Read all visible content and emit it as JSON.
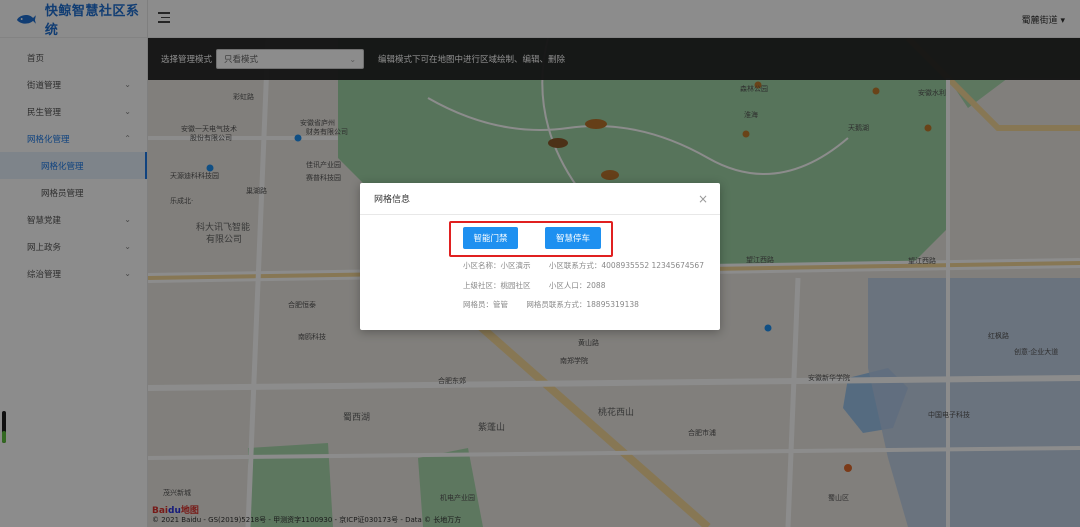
{
  "app": {
    "title": "快鲸智慧社区系统",
    "user": "蜀麓街道 ▾"
  },
  "sidebar": {
    "items": [
      {
        "label": "首页"
      },
      {
        "label": "街道管理",
        "chev": "⌄"
      },
      {
        "label": "民生管理",
        "chev": "⌄"
      },
      {
        "label": "网格化管理",
        "chev": "⌃"
      },
      {
        "label": "网格化管理"
      },
      {
        "label": "网格员管理"
      },
      {
        "label": "智慧党建",
        "chev": "⌄"
      },
      {
        "label": "网上政务",
        "chev": "⌄"
      },
      {
        "label": "综治管理",
        "chev": "⌄"
      }
    ]
  },
  "toolbar": {
    "mode_label": "选择管理模式",
    "mode_value": "只看模式",
    "hint": "编辑模式下可在地图中进行区域绘制、编辑、删除"
  },
  "map": {
    "labels": [
      "彩虹路",
      "安徽一天电气技术",
      "股份有限公司",
      "安徽省庐州",
      "财务有限公司",
      "佳讯产业园",
      "赛普科技园",
      "天源迪科科技园",
      "乐成北·",
      "巢湖路",
      "科大讯飞智能",
      "有限公司",
      "森林公园",
      "淮海",
      "天鹅湖",
      "望江西路",
      "安徽水利",
      "南鸥科技",
      "合肥恒泰",
      "安徽新华学院",
      "黄山路",
      "南郑学院",
      "蜀西湖",
      "中国电子科技",
      "红枫路",
      "创意·企业大道",
      "紫蓬山",
      "合肥东郊",
      "桃花西山",
      "合肥市浦",
      "机电产业园",
      "蜀山区",
      "望江西路",
      "茂兴新城"
    ],
    "baidu": "Bai",
    "baidu_b": "du",
    "baidu_suffix": "地图",
    "copyright": "© 2021 Baidu - GS(2019)5218号 - 甲测资字1100930 - 京ICP证030173号 - Data © 长地万方"
  },
  "modal": {
    "title": "网格信息",
    "close": "×",
    "buttons": {
      "gate": "智能门禁",
      "parking": "智慧停车"
    },
    "info": {
      "row1": [
        "小区名称：小区演示",
        "小区联系方式：4008935552 12345674567"
      ],
      "row2": [
        "上级社区：桃园社区",
        "小区人口：2088"
      ],
      "row3": [
        "网格员：管管",
        "网格员联系方式：18895319138"
      ]
    }
  }
}
